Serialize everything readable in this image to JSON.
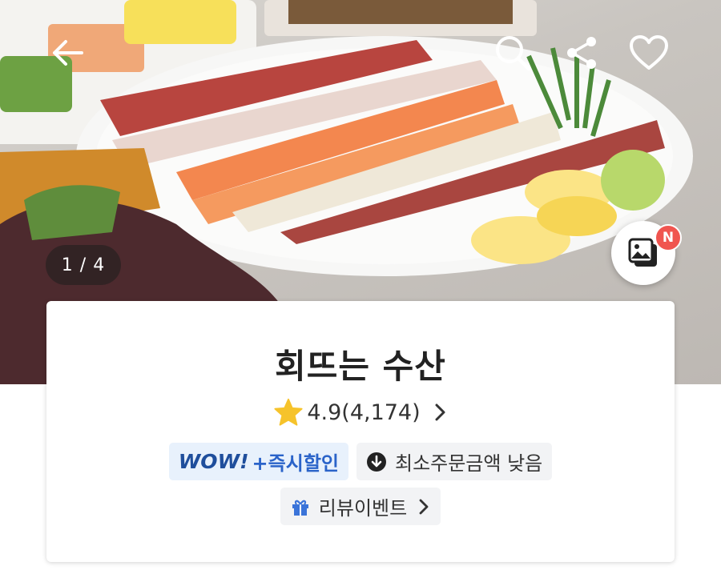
{
  "hero": {
    "pager_text": "1 / 4",
    "new_badge": "N",
    "icons": {
      "back": "arrow-left-icon",
      "search": "search-icon",
      "share": "share-icon",
      "like": "heart-icon",
      "photo_review": "photo-review-icon"
    }
  },
  "store": {
    "name": "회뜨는 수산",
    "rating": "4.9",
    "review_count": "(4,174)"
  },
  "tags": {
    "wow_mark": "WOW!",
    "wow_text": "+즉시할인",
    "min_order": "최소주문금액 낮음",
    "review_event": "리뷰이벤트"
  },
  "colors": {
    "star": "#f6c32b",
    "wow_brand": "#1f4e9c",
    "badge": "#f0554f"
  }
}
